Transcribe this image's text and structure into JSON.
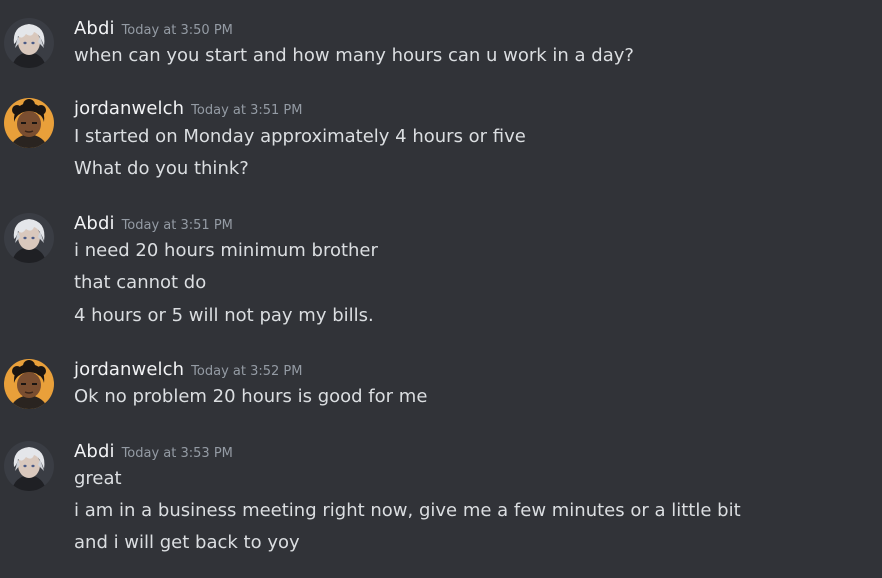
{
  "groups": [
    {
      "author": "Abdi",
      "avatar_icon": "white-haired-anime-avatar-icon",
      "timestamp": "Today at 3:50 PM",
      "lines": [
        "when can you start and how many hours can u work in a day?"
      ]
    },
    {
      "author": "jordanwelch",
      "avatar_icon": "cartoon-boy-avatar-icon",
      "timestamp": "Today at 3:51 PM",
      "lines": [
        "I started on Monday  approximately 4 hours or five",
        "What do you think?"
      ]
    },
    {
      "author": "Abdi",
      "avatar_icon": "white-haired-anime-avatar-icon",
      "timestamp": "Today at 3:51 PM",
      "lines": [
        "i need 20 hours minimum brother",
        "that cannot do",
        "4 hours or 5 will not pay my bills."
      ]
    },
    {
      "author": "jordanwelch",
      "avatar_icon": "cartoon-boy-avatar-icon",
      "timestamp": "Today at 3:52 PM",
      "lines": [
        "Ok no problem 20 hours is good for me"
      ]
    },
    {
      "author": "Abdi",
      "avatar_icon": "white-haired-anime-avatar-icon",
      "timestamp": "Today at 3:53 PM",
      "lines": [
        "great",
        "i am in a business meeting right now, give me a few minutes or a little bit",
        "and i will get back to yoy"
      ]
    }
  ],
  "colors": {
    "background": "#313338",
    "username": "#f2f3f5",
    "timestamp": "#949ba4",
    "message_text": "#dbdee1"
  }
}
